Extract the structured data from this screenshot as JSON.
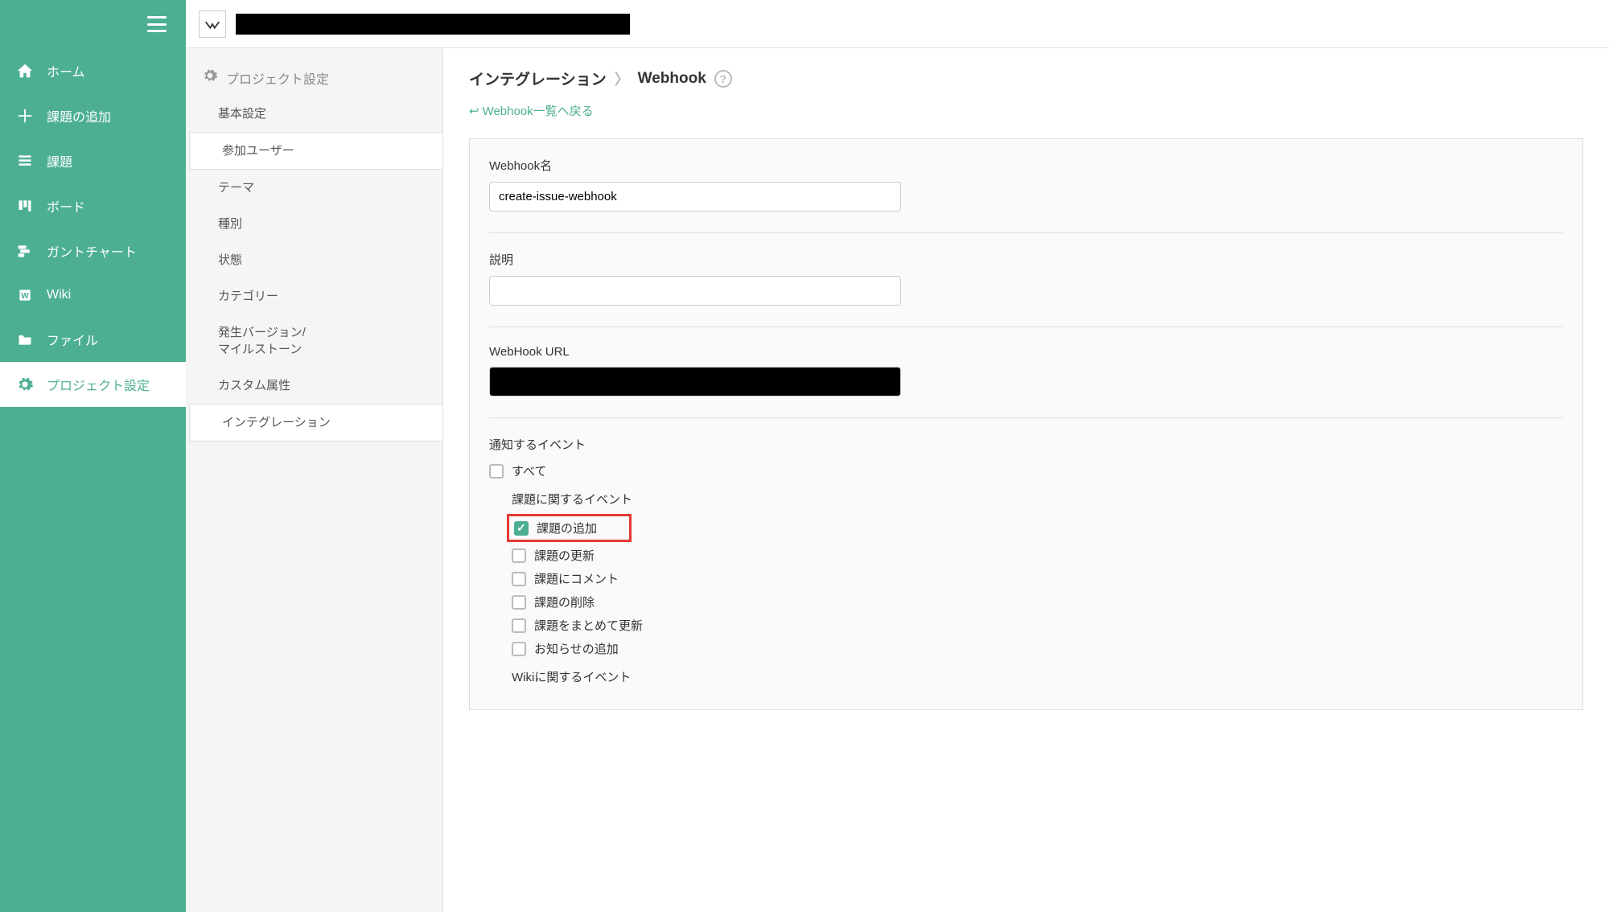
{
  "sidebar": {
    "items": [
      {
        "label": "ホーム",
        "icon": "home-icon"
      },
      {
        "label": "課題の追加",
        "icon": "plus-icon"
      },
      {
        "label": "課題",
        "icon": "list-icon"
      },
      {
        "label": "ボード",
        "icon": "board-icon"
      },
      {
        "label": "ガントチャート",
        "icon": "gantt-icon"
      },
      {
        "label": "Wiki",
        "icon": "wiki-icon"
      },
      {
        "label": "ファイル",
        "icon": "file-icon"
      },
      {
        "label": "プロジェクト設定",
        "icon": "gear-icon",
        "active": true
      }
    ]
  },
  "settings": {
    "header": "プロジェクト設定",
    "items": [
      {
        "label": "基本設定"
      },
      {
        "label": "参加ユーザー",
        "active": true
      },
      {
        "label": "テーマ"
      },
      {
        "label": "種別"
      },
      {
        "label": "状態"
      },
      {
        "label": "カテゴリー"
      },
      {
        "label": "発生バージョン/\nマイルストーン"
      },
      {
        "label": "カスタム属性"
      },
      {
        "label": "インテグレーション",
        "active": true
      }
    ]
  },
  "breadcrumb": {
    "part1": "インテグレーション",
    "sep": "〉",
    "part2": "Webhook"
  },
  "back_link": "Webhook一覧へ戻る",
  "form": {
    "name_label": "Webhook名",
    "name_value": "create-issue-webhook",
    "desc_label": "説明",
    "desc_value": "",
    "url_label": "WebHook URL",
    "events_label": "通知するイベント",
    "all_label": "すべて",
    "group1_label": "課題に関するイベント",
    "group1_items": [
      {
        "label": "課題の追加",
        "checked": true,
        "highlight": true
      },
      {
        "label": "課題の更新",
        "checked": false
      },
      {
        "label": "課題にコメント",
        "checked": false
      },
      {
        "label": "課題の削除",
        "checked": false
      },
      {
        "label": "課題をまとめて更新",
        "checked": false
      },
      {
        "label": "お知らせの追加",
        "checked": false
      }
    ],
    "group2_label": "Wikiに関するイベント"
  }
}
